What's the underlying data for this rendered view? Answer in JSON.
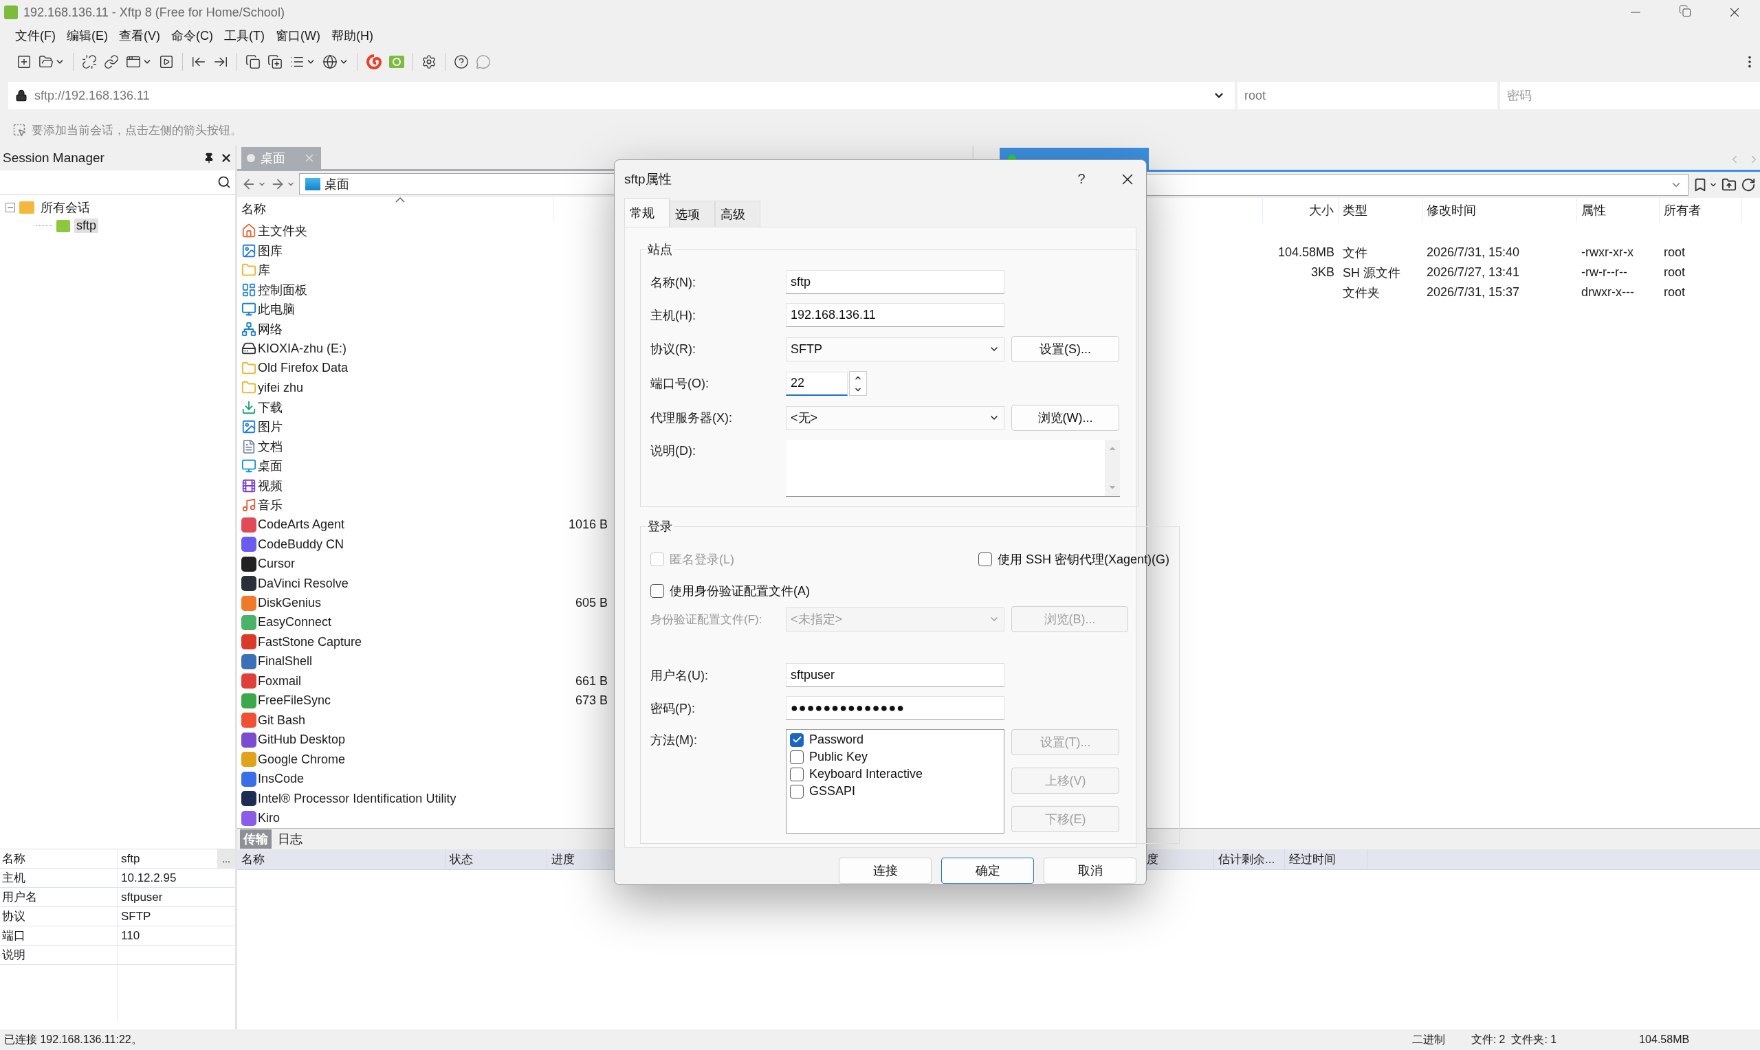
{
  "window": {
    "title": "192.168.136.11 - Xftp 8 (Free for Home/School)"
  },
  "menu": [
    "文件(F)",
    "编辑(E)",
    "查看(V)",
    "命令(C)",
    "工具(T)",
    "窗口(W)",
    "帮助(H)"
  ],
  "address": {
    "url": "sftp://192.168.136.11",
    "user": "root",
    "password_placeholder": "密码"
  },
  "hint": "要添加当前会话，点击左侧的箭头按钮。",
  "session_manager": {
    "title": "Session Manager",
    "tree": [
      {
        "label": "所有会话",
        "expanded": true,
        "selected": false,
        "children": [
          {
            "label": "sftp",
            "selected": true
          }
        ]
      }
    ]
  },
  "session_properties": [
    {
      "key": "名称",
      "value": "sftp",
      "button": "..."
    },
    {
      "key": "主机",
      "value": "10.12.2.95"
    },
    {
      "key": "用户名",
      "value": "sftpuser"
    },
    {
      "key": "协议",
      "value": "SFTP"
    },
    {
      "key": "端口",
      "value": "110"
    },
    {
      "key": "说明"
    }
  ],
  "local_pane": {
    "tab": "桌面",
    "path": "桌面",
    "name_column": "名称",
    "rows": [
      {
        "name": "主文件夹"
      },
      {
        "name": "图库"
      },
      {
        "name": "库"
      },
      {
        "name": "控制面板"
      },
      {
        "name": "此电脑"
      },
      {
        "name": "网络"
      },
      {
        "name": "KIOXIA-zhu (E:)"
      },
      {
        "name": "Old Firefox Data"
      },
      {
        "name": "yifei zhu"
      },
      {
        "name": "下载"
      },
      {
        "name": "图片"
      },
      {
        "name": "文档"
      },
      {
        "name": "桌面"
      },
      {
        "name": "视频"
      },
      {
        "name": "音乐"
      },
      {
        "name": "CodeArts Agent",
        "size": "1016 B"
      },
      {
        "name": "CodeBuddy CN"
      },
      {
        "name": "Cursor"
      },
      {
        "name": "DaVinci Resolve"
      },
      {
        "name": "DiskGenius",
        "size": "605 B"
      },
      {
        "name": "EasyConnect"
      },
      {
        "name": "FastStone Capture"
      },
      {
        "name": "FinalShell"
      },
      {
        "name": "Foxmail",
        "size": "661 B"
      },
      {
        "name": "FreeFileSync",
        "size": "673 B"
      },
      {
        "name": "Git Bash"
      },
      {
        "name": "GitHub Desktop"
      },
      {
        "name": "Google Chrome"
      },
      {
        "name": "InsCode"
      },
      {
        "name": "Intel® Processor Identification Utility"
      },
      {
        "name": "Kiro"
      }
    ]
  },
  "remote_pane": {
    "columns": [
      "大小",
      "类型",
      "修改时间",
      "属性",
      "所有者"
    ],
    "rows": [
      {
        "size": "104.58MB",
        "type": "文件",
        "modified": "2026/7/31, 15:40",
        "attributes": "-rwxr-xr-x",
        "owner": "root"
      },
      {
        "size": "3KB",
        "type": "SH 源文件",
        "modified": "2026/7/27, 13:41",
        "attributes": "-rw-r--r--",
        "owner": "root"
      },
      {
        "size": "",
        "type": "文件夹",
        "modified": "2026/7/31, 15:37",
        "attributes": "drwxr-x---",
        "owner": "root"
      }
    ]
  },
  "transfer": {
    "tabs": [
      {
        "label": "传输",
        "selected": true
      },
      {
        "label": "日志",
        "selected": false
      }
    ],
    "columns": [
      "名称",
      "状态",
      "进度",
      "度",
      "估计剩余...",
      "经过时间"
    ]
  },
  "status_bar": {
    "connection": "已连接 192.168.136.11:22。",
    "mode": "二进制",
    "counts": "文件: 2  文件夹: 1",
    "size": "104.58MB"
  },
  "dialog": {
    "title": "sftp属性",
    "help": "?",
    "tabs": [
      {
        "label": "常规",
        "selected": true
      },
      {
        "label": "选项",
        "selected": false
      },
      {
        "label": "高级",
        "selected": false
      }
    ],
    "site": {
      "legend": "站点",
      "name": {
        "label": "名称(N):",
        "value": "sftp"
      },
      "host": {
        "label": "主机(H):",
        "value": "192.168.136.11"
      },
      "protocol": {
        "label": "协议(R):",
        "value": "SFTP",
        "button": "设置(S)..."
      },
      "port": {
        "label": "端口号(O):",
        "value": "22"
      },
      "proxy": {
        "label": "代理服务器(X):",
        "value": "<无>",
        "button": "浏览(W)..."
      },
      "description": {
        "label": "说明(D):"
      }
    },
    "login": {
      "legend": "登录",
      "anonymous": {
        "label": "匿名登录(L)",
        "checked": false,
        "disabled": true
      },
      "xagent": {
        "label": "使用 SSH 密钥代理(Xagent)(G)",
        "checked": false,
        "disabled": false
      },
      "use_profile": {
        "label": "使用身份验证配置文件(A)",
        "checked": false,
        "disabled": false
      },
      "profile": {
        "label": "身份验证配置文件(F):",
        "value": "<未指定>",
        "button": "浏览(B)...",
        "disabled": true
      },
      "username": {
        "label": "用户名(U):",
        "value": "sftpuser"
      },
      "password": {
        "label": "密码(P):",
        "value": "●●●●●●●●●●●●●●"
      },
      "method": {
        "label": "方法(M):",
        "options": [
          {
            "label": "Password",
            "checked": true
          },
          {
            "label": "Public Key",
            "checked": false
          },
          {
            "label": "Keyboard Interactive",
            "checked": false
          },
          {
            "label": "GSSAPI",
            "checked": false
          }
        ],
        "buttons": [
          {
            "label": "设置(T)...",
            "disabled": true
          },
          {
            "label": "上移(V)",
            "disabled": true
          },
          {
            "label": "下移(E)",
            "disabled": true
          }
        ]
      }
    },
    "buttons": [
      {
        "label": "连接",
        "default": false
      },
      {
        "label": "确定",
        "default": true
      },
      {
        "label": "取消",
        "default": false
      }
    ]
  }
}
